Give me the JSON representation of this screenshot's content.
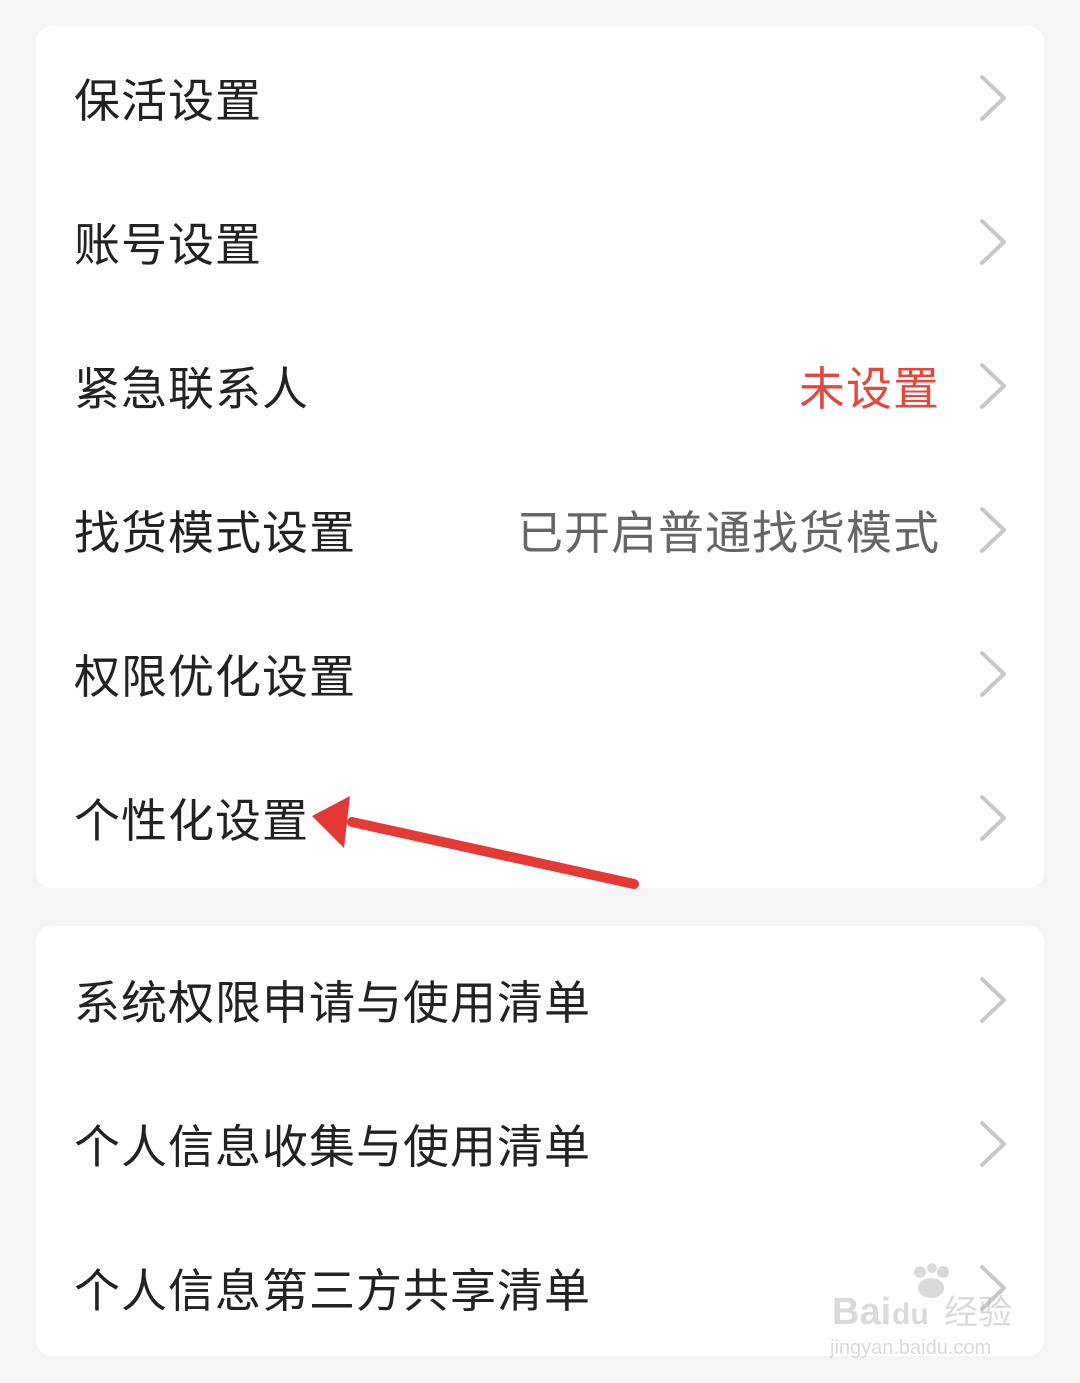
{
  "colors": {
    "background": "#f5f5f5",
    "card": "#ffffff",
    "label": "#222222",
    "value_gray": "#666666",
    "value_red": "#e0493c",
    "chevron": "#c8c8c8",
    "arrow": "#e53935"
  },
  "section1": {
    "items": [
      {
        "label": "保活设置",
        "value": "",
        "icon": "chevron-right-icon"
      },
      {
        "label": "账号设置",
        "value": "",
        "icon": "chevron-right-icon"
      },
      {
        "label": "紧急联系人",
        "value": "未设置",
        "value_color": "#e0493c",
        "icon": "chevron-right-icon"
      },
      {
        "label": "找货模式设置",
        "value": "已开启普通找货模式",
        "value_color": "#666666",
        "icon": "chevron-right-icon"
      },
      {
        "label": "权限优化设置",
        "value": "",
        "icon": "chevron-right-icon"
      },
      {
        "label": "个性化设置",
        "value": "",
        "icon": "chevron-right-icon"
      }
    ]
  },
  "section2": {
    "items": [
      {
        "label": "系统权限申请与使用清单",
        "icon": "chevron-right-icon"
      },
      {
        "label": "个人信息收集与使用清单",
        "icon": "chevron-right-icon"
      },
      {
        "label": "个人信息第三方共享清单",
        "icon": "chevron-right-icon"
      }
    ]
  },
  "annotation": {
    "type": "arrow",
    "points_to": "个性化设置",
    "color": "#e53935"
  },
  "watermark": {
    "brand": "Baidu经验",
    "url": "jingyan.baidu.com"
  }
}
